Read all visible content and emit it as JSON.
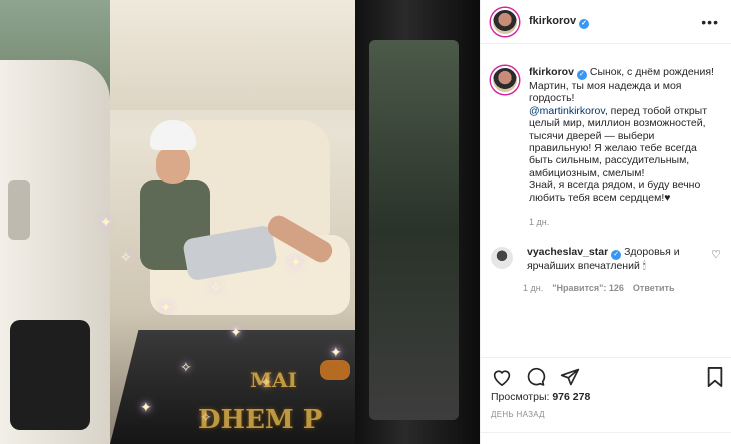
{
  "post": {
    "username": "fkirkorov",
    "more_icon": "more-horizontal-icon",
    "caption": {
      "username": "fkirkorov",
      "line1": "Сынок, с днём рождения!",
      "line2": "Мартин, ты моя надежда и моя гордость!",
      "mention": "@martinkirkorov",
      "line3": ", перед тобой открыт целый мир, миллион возможностей, тысячи дверей — выбери правильную! Я желаю тебе всегда быть сильным, рассудительным, амбициозным, смелым!",
      "line4": "Знай, я всегда рядом, и буду вечно любить тебя всем сердцем!",
      "heart": "♥",
      "time": "1 дн."
    },
    "comment": {
      "username": "vyacheslav_star",
      "text": "Здоровья и ярчайших впечатлений",
      "emoji": "🕯",
      "time": "1 дн.",
      "likes": "\"Нравится\": 126",
      "reply": "Ответить"
    },
    "views_label": "Просмотры:",
    "views_value": "976 278",
    "posted": "ДЕНЬ НАЗАД"
  },
  "photo": {
    "overlay_line1": "MAI",
    "overlay_line2": "DHEM P"
  },
  "colors": {
    "verified": "#3897f0",
    "mention": "#00376b",
    "muted": "#8e8e8e",
    "story_ring": "#d6249f"
  }
}
